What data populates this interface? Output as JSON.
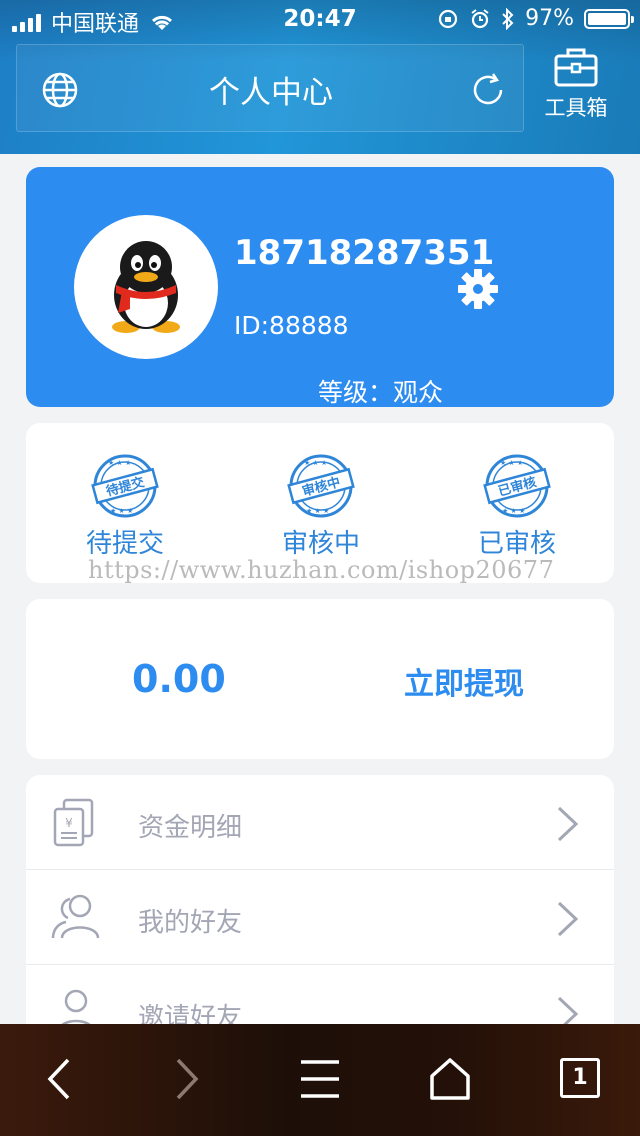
{
  "statusbar": {
    "carrier": "中国联通",
    "time": "20:47",
    "battery": "97%"
  },
  "header": {
    "title": "个人中心",
    "toolbox_label": "工具箱"
  },
  "profile": {
    "phone": "18718287351",
    "id": "ID:88888",
    "level": "等级：观众"
  },
  "statuses": [
    {
      "stamp": "待提交",
      "label": "待提交"
    },
    {
      "stamp": "审核中",
      "label": "审核中"
    },
    {
      "stamp": "已审核",
      "label": "已审核"
    }
  ],
  "watermark": "https://www.huzhan.com/ishop20677",
  "balance": {
    "amount": "0.00",
    "withdraw_label": "立即提现"
  },
  "menu": [
    {
      "label": "资金明细",
      "icon": "money-document-icon"
    },
    {
      "label": "我的好友",
      "icon": "friends-icon"
    },
    {
      "label": "邀请好友",
      "icon": "user-icon"
    }
  ],
  "bottombar": {
    "tab_count": "1"
  },
  "colors": {
    "primary": "#2d8cf0",
    "header": "#2196d8",
    "menu_text": "#a3a6b4"
  }
}
